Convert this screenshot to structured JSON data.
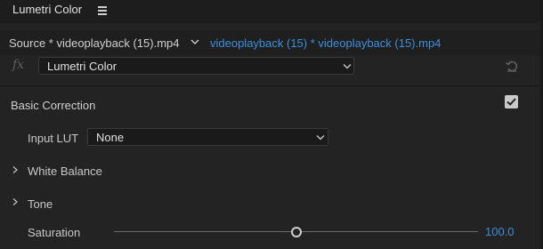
{
  "panel": {
    "title": "Lumetri Color"
  },
  "source_bar": {
    "source_label": "Source * videoplayback (15).mp4",
    "clip_label": "videoplayback (15) * videoplayback (15).mp4"
  },
  "effect": {
    "fx_label": "fx",
    "selected": "Lumetri Color"
  },
  "basic_correction": {
    "title": "Basic Correction",
    "enabled": true,
    "input_lut": {
      "label": "Input LUT",
      "value": "None"
    },
    "white_balance": {
      "label": "White Balance",
      "expanded": false
    },
    "tone": {
      "label": "Tone",
      "expanded": false
    },
    "saturation": {
      "label": "Saturation",
      "value": "100.0",
      "fraction": 0.5
    }
  },
  "colors": {
    "accent_blue": "#3d8fdc",
    "panel_bg": "#232323"
  }
}
